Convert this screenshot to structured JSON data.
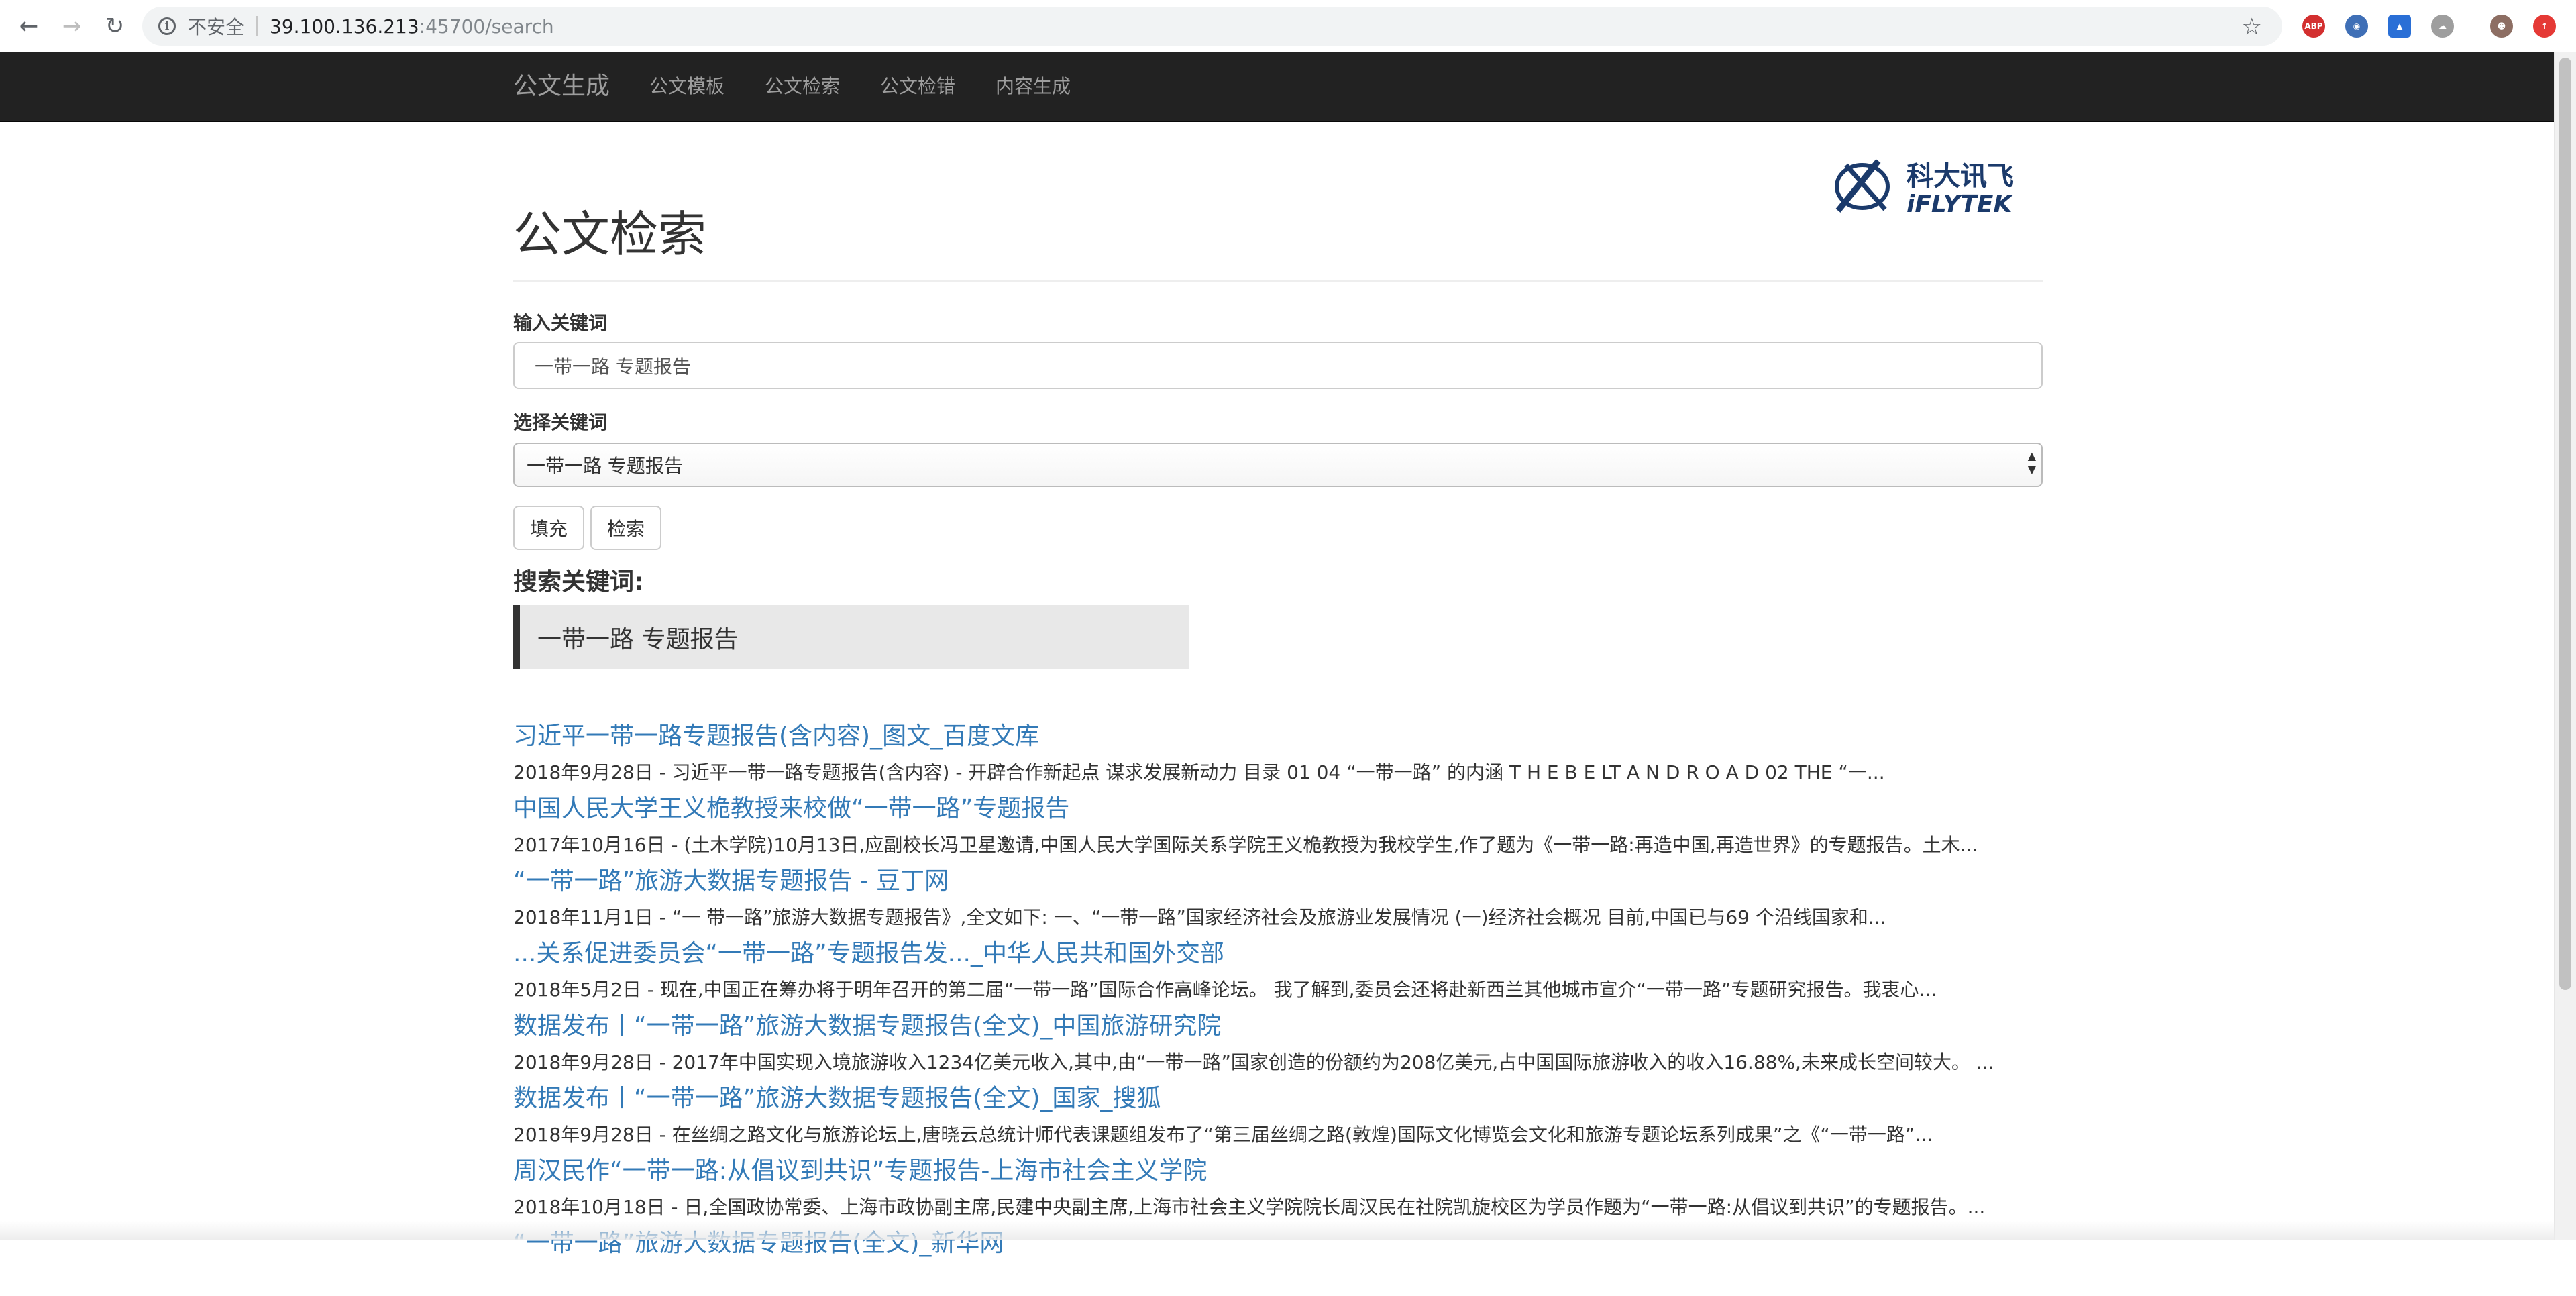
{
  "browser": {
    "insecure_label": "不安全",
    "url_host": "39.100.136.213",
    "url_rest": ":45700/search"
  },
  "navbar": {
    "brand": "公文生成",
    "links": [
      "公文模板",
      "公文检索",
      "公文检错",
      "内容生成"
    ]
  },
  "logo": {
    "cn": "科大讯飞",
    "en": "iFLYTEK"
  },
  "page": {
    "title": "公文检索",
    "input_label": "输入关键词",
    "input_value": "一带一路 专题报告",
    "select_label": "选择关键词",
    "select_value": "一带一路 专题报告",
    "fill_button": "填充",
    "search_button": "检索",
    "keyword_heading": "搜索关键词:",
    "keyword_value": "一带一路 专题报告"
  },
  "results": [
    {
      "title": "习近平一带一路专题报告(含内容)_图文_百度文库",
      "snippet": "2018年9月28日 - 习近平一带一路专题报告(含内容) - 开辟合作新起点 谋求发展新动力 目录 01 04 “一带一路” 的内涵 T H E B E LT A N D R O A D 02 THE “一..."
    },
    {
      "title": "中国人民大学王义桅教授来校做“一带一路”专题报告",
      "snippet": "2017年10月16日 - (土木学院)10月13日,应副校长冯卫星邀请,中国人民大学国际关系学院王义桅教授为我校学生,作了题为《一带一路:再造中国,再造世界》的专题报告。土木..."
    },
    {
      "title": "“一带一路”旅游大数据专题报告 - 豆丁网",
      "snippet": "2018年11月1日 - “一 带一路”旅游大数据专题报告》,全文如下: 一、“一带一路”国家经济社会及旅游业发展情况 (一)经济社会概况 目前,中国已与69 个沿线国家和..."
    },
    {
      "title": "...关系促进委员会“一带一路”专题报告发..._中华人民共和国外交部",
      "snippet": "2018年5月2日 - 现在,中国正在筹办将于明年召开的第二届“一带一路”国际合作高峰论坛。 我了解到,委员会还将赴新西兰其他城市宣介“一带一路”专题研究报告。我衷心..."
    },
    {
      "title": "数据发布丨“一带一路”旅游大数据专题报告(全文)_中国旅游研究院",
      "snippet": "2018年9月28日 - 2017年中国实现入境旅游收入1234亿美元收入,其中,由“一带一路”国家创造的份额约为208亿美元,占中国国际旅游收入的收入16.88%,未来成长空间较大。 ..."
    },
    {
      "title": "数据发布丨“一带一路”旅游大数据专题报告(全文)_国家_搜狐",
      "snippet": "2018年9月28日 - 在丝绸之路文化与旅游论坛上,唐晓云总统计师代表课题组发布了“第三届丝绸之路(敦煌)国际文化博览会文化和旅游专题论坛系列成果”之《“一带一路”..."
    },
    {
      "title": "周汉民作“一带一路:从倡议到共识”专题报告-上海市社会主义学院",
      "snippet": "2018年10月18日 - 日,全国政协常委、上海市政协副主席,民建中央副主席,上海市社会主义学院院长周汉民在社院凯旋校区为学员作题为“一带一路:从倡议到共识”的专题报告。..."
    },
    {
      "title": "“一带一路”旅游大数据专题报告(全文)_新华网",
      "snippet": ""
    }
  ]
}
